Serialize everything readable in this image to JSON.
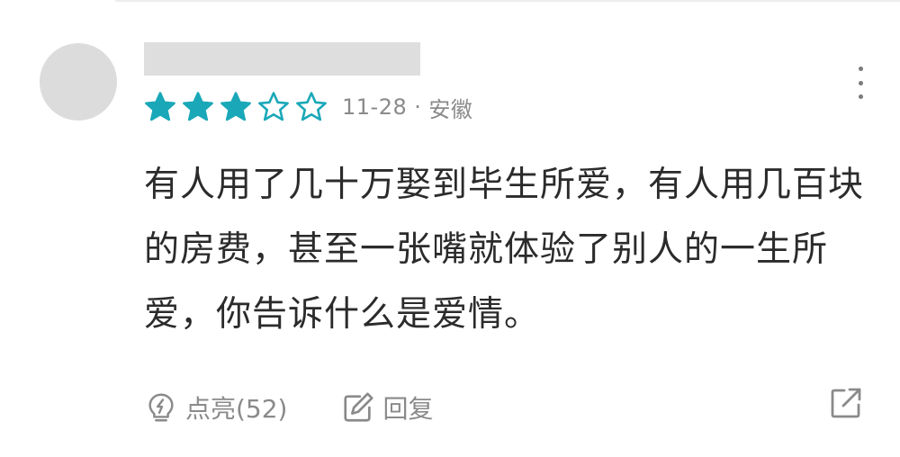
{
  "review": {
    "rating": 3,
    "max_rating": 5,
    "date": "11-28",
    "separator": "·",
    "location": "安徽",
    "text": "有人用了几十万娶到毕生所爱，有人用几百块的房费，甚至一张嘴就体验了别人的一生所爱，你告诉什么是爱情。"
  },
  "actions": {
    "like_label": "点亮(52)",
    "reply_label": "回复"
  },
  "colors": {
    "star_accent": "#1aa8b8",
    "meta_text": "#8a8a8a",
    "body_text": "#2b2b2b"
  },
  "icons": {
    "more": "more-vertical-icon",
    "like": "lightbulb-icon",
    "reply": "edit-icon",
    "share": "share-icon"
  }
}
